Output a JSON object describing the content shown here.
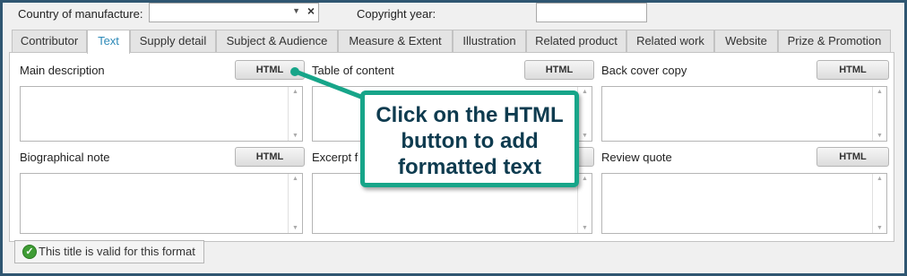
{
  "header": {
    "country_label": "Country of manufacture:",
    "country_value": "",
    "copyright_label": "Copyright year:",
    "copyright_value": ""
  },
  "tabs": [
    {
      "label": "Contributor",
      "active": false
    },
    {
      "label": "Text",
      "active": true
    },
    {
      "label": "Supply detail",
      "active": false
    },
    {
      "label": "Subject & Audience",
      "active": false
    },
    {
      "label": "Measure & Extent",
      "active": false
    },
    {
      "label": "Illustration",
      "active": false
    },
    {
      "label": "Related product",
      "active": false
    },
    {
      "label": "Related work",
      "active": false
    },
    {
      "label": "Website",
      "active": false
    },
    {
      "label": "Prize & Promotion",
      "active": false
    }
  ],
  "fields": {
    "main_description": {
      "label": "Main description",
      "button": "HTML",
      "value": ""
    },
    "table_of_content": {
      "label": "Table of content",
      "button": "HTML",
      "value": ""
    },
    "back_cover_copy": {
      "label": "Back cover copy",
      "button": "HTML",
      "value": ""
    },
    "biographical_note": {
      "label": "Biographical note",
      "button": "HTML",
      "value": ""
    },
    "excerpt": {
      "label": "Excerpt f",
      "button": "HTML",
      "value": ""
    },
    "review_quote": {
      "label": "Review quote",
      "button": "HTML",
      "value": ""
    }
  },
  "status": {
    "text": "This title is valid for this format",
    "color": "#3f9c35"
  },
  "callout": {
    "line1": "Click on the HTML",
    "line2": "button to add",
    "line3": "formatted text",
    "color": "#17a589"
  },
  "colors": {
    "frame": "#2f5671",
    "active_tab": "#2e8ab8"
  }
}
